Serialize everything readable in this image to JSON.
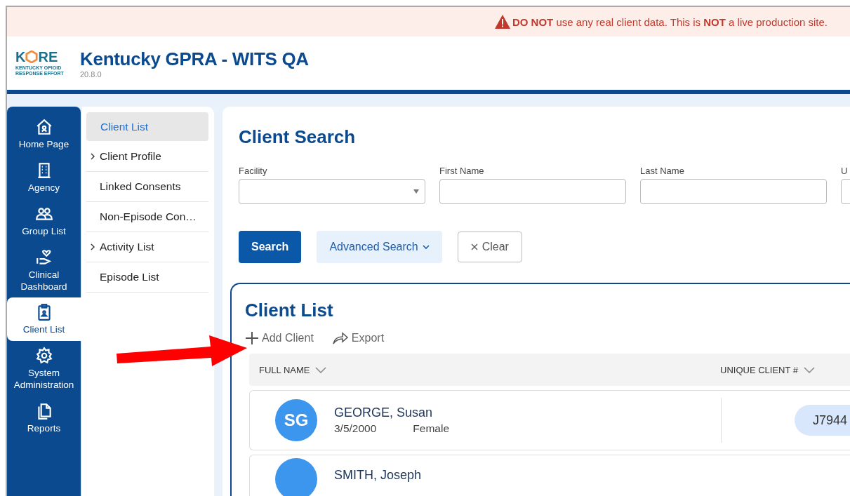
{
  "banner": {
    "text": "**DO NOT** use any real client data. This is **NOT** a live production site."
  },
  "header": {
    "logo_left": "K",
    "logo_right": "RE",
    "logo_tagline": "KENTUCKY OPIOID RESPONSE EFFORT",
    "title": "Kentucky GPRA - WITS QA",
    "version": "20.8.0"
  },
  "nav": [
    {
      "label": "Home Page",
      "selected": false
    },
    {
      "label": "Agency",
      "selected": false
    },
    {
      "label": "Group List",
      "selected": false
    },
    {
      "label": "Clinical Dashboard",
      "selected": false
    },
    {
      "label": "Client List",
      "selected": true
    },
    {
      "label": "System Administration",
      "selected": false
    },
    {
      "label": "Reports",
      "selected": false
    }
  ],
  "submenu": [
    {
      "label": "Client List",
      "selected": true,
      "expandable": false
    },
    {
      "label": "Client Profile",
      "selected": false,
      "expandable": true
    },
    {
      "label": "Linked Consents",
      "selected": false,
      "expandable": false
    },
    {
      "label": "Non-Episode Con…",
      "selected": false,
      "expandable": false
    },
    {
      "label": "Activity List",
      "selected": false,
      "expandable": true
    },
    {
      "label": "Episode List",
      "selected": false,
      "expandable": false
    }
  ],
  "search": {
    "title": "Client Search",
    "fields": [
      {
        "label": "Facility",
        "kind": "select"
      },
      {
        "label": "First Name",
        "kind": "text"
      },
      {
        "label": "Last Name",
        "kind": "text"
      },
      {
        "label": "U",
        "kind": "text"
      }
    ],
    "buttons": [
      {
        "label": "Search",
        "kind": "primary"
      },
      {
        "label": "Advanced Search",
        "kind": "dropdown"
      },
      {
        "label": "Clear",
        "kind": "clear"
      }
    ]
  },
  "client_list": {
    "title": "Client List",
    "actions": [
      {
        "label": "Add Client"
      },
      {
        "label": "Export"
      }
    ],
    "columns": [
      "FULL NAME",
      "UNIQUE CLIENT #"
    ],
    "rows": [
      {
        "initials": "SG",
        "name": "GEORGE, Susan",
        "dob": "3/5/2000",
        "gender": "Female",
        "client_id": "J7944"
      },
      {
        "name": "SMITH, Joseph"
      }
    ]
  }
}
